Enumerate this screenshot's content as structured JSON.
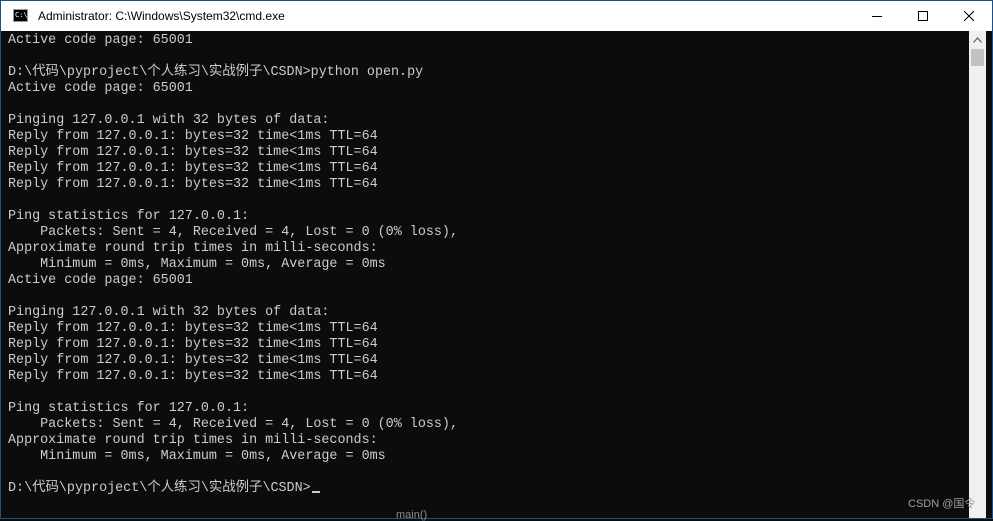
{
  "window": {
    "title": "Administrator: C:\\Windows\\System32\\cmd.exe",
    "icon": "cmd-icon",
    "icon_text": "C:\\"
  },
  "controls": {
    "minimize_icon": "minimize-icon",
    "maximize_icon": "maximize-icon",
    "close_icon": "close-icon"
  },
  "console": {
    "lines": [
      "Active code page: 65001",
      "",
      "D:\\代码\\pyproject\\个人练习\\实战例子\\CSDN>python open.py",
      "Active code page: 65001",
      "",
      "Pinging 127.0.0.1 with 32 bytes of data:",
      "Reply from 127.0.0.1: bytes=32 time<1ms TTL=64",
      "Reply from 127.0.0.1: bytes=32 time<1ms TTL=64",
      "Reply from 127.0.0.1: bytes=32 time<1ms TTL=64",
      "Reply from 127.0.0.1: bytes=32 time<1ms TTL=64",
      "",
      "Ping statistics for 127.0.0.1:",
      "    Packets: Sent = 4, Received = 4, Lost = 0 (0% loss),",
      "Approximate round trip times in milli-seconds:",
      "    Minimum = 0ms, Maximum = 0ms, Average = 0ms",
      "Active code page: 65001",
      "",
      "Pinging 127.0.0.1 with 32 bytes of data:",
      "Reply from 127.0.0.1: bytes=32 time<1ms TTL=64",
      "Reply from 127.0.0.1: bytes=32 time<1ms TTL=64",
      "Reply from 127.0.0.1: bytes=32 time<1ms TTL=64",
      "Reply from 127.0.0.1: bytes=32 time<1ms TTL=64",
      "",
      "Ping statistics for 127.0.0.1:",
      "    Packets: Sent = 4, Received = 4, Lost = 0 (0% loss),",
      "Approximate round trip times in milli-seconds:",
      "    Minimum = 0ms, Maximum = 0ms, Average = 0ms",
      "",
      "D:\\代码\\pyproject\\个人练习\\实战例子\\CSDN>"
    ]
  },
  "watermark": "CSDN @国令",
  "background_snippet": "main()",
  "colors": {
    "console_bg": "#0c0c0c",
    "console_fg": "#cccccc",
    "titlebar_bg": "#ffffff"
  }
}
